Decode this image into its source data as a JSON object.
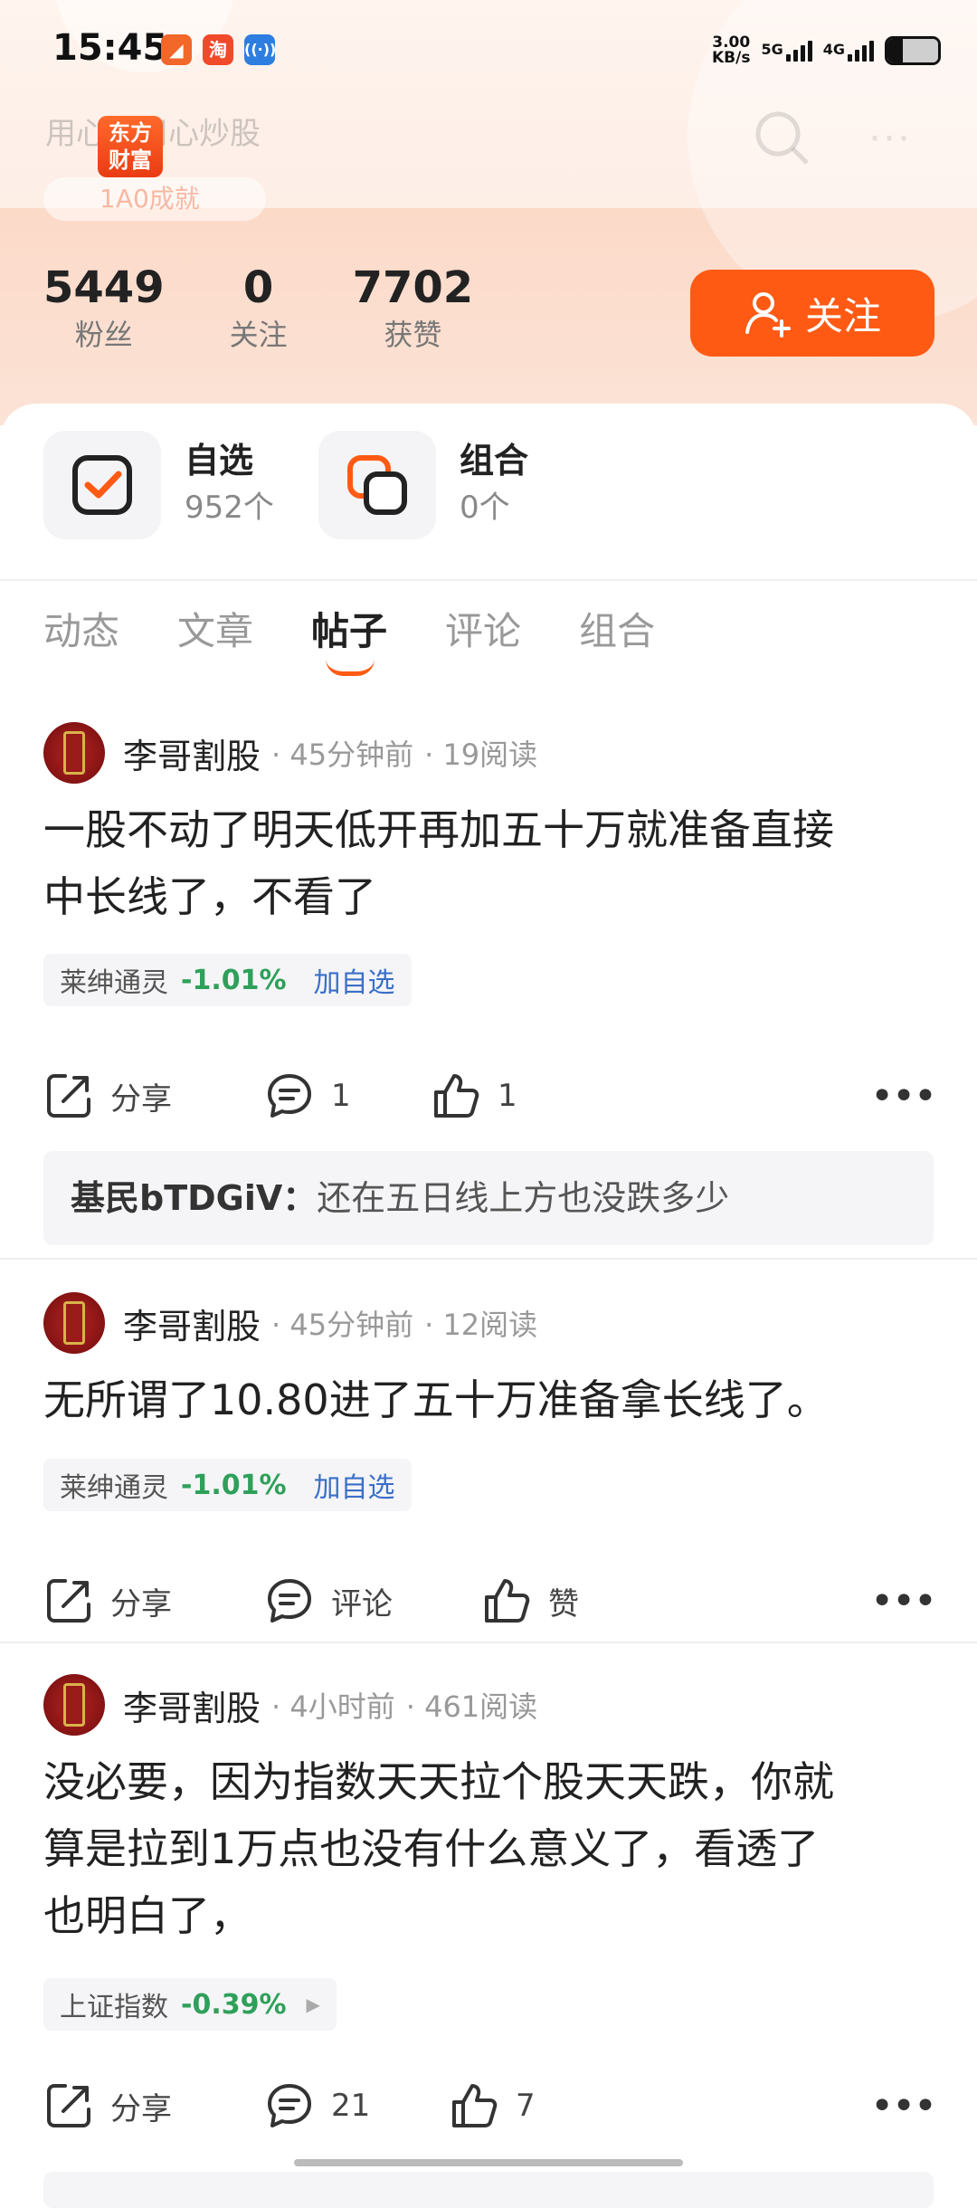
{
  "status": {
    "time": "15:45",
    "speed_value": "3.00",
    "speed_unit": "KB/s",
    "net1": "5G",
    "net2": "4G",
    "battery_level": 0.3
  },
  "header": {
    "logo_line1": "东方",
    "logo_line2": "财富",
    "slogan": "用心，用心炒股",
    "honor": "1A0成就"
  },
  "profile": {
    "stats": [
      {
        "value": "5449",
        "label": "粉丝"
      },
      {
        "value": "0",
        "label": "关注"
      },
      {
        "value": "7702",
        "label": "获赞"
      }
    ],
    "follow_label": "关注"
  },
  "quick": [
    {
      "title": "自选",
      "sub": "952个"
    },
    {
      "title": "组合",
      "sub": "0个"
    }
  ],
  "tabs": [
    {
      "label": "动态"
    },
    {
      "label": "文章"
    },
    {
      "label": "帖子"
    },
    {
      "label": "评论"
    },
    {
      "label": "组合"
    }
  ],
  "posts": [
    {
      "author": "李哥割股",
      "time": "· 45分钟前",
      "reads": "· 19阅读",
      "line1": "一股不动了明天低开再加五十万就准备直接",
      "line2": "中长线了，不看了",
      "stock_name": "莱绅通灵",
      "stock_pct": "-1.01%",
      "stock_add": "加自选",
      "share": "分享",
      "comments": "1",
      "likes": "1",
      "comment_user": "基民bTDGiV：",
      "comment_text": "还在五日线上方也没跌多少"
    },
    {
      "author": "李哥割股",
      "time": "· 45分钟前",
      "reads": "· 12阅读",
      "line1": "无所谓了10.80进了五十万准备拿长线了。",
      "stock_name": "莱绅通灵",
      "stock_pct": "-1.01%",
      "stock_add": "加自选",
      "share": "分享",
      "comments": "评论",
      "likes": "赞"
    },
    {
      "author": "李哥割股",
      "time": "· 4小时前",
      "reads": "· 461阅读",
      "line1": "没必要，因为指数天天拉个股天天跌，你就",
      "line2": "算是拉到1万点也没有什么意义了，看透了",
      "line3": "也明白了，",
      "stock_name": "上证指数",
      "stock_pct": "-0.39%",
      "share": "分享",
      "comments": "21",
      "likes": "7"
    }
  ],
  "colors": {
    "accent": "#ff5a14",
    "down_green": "#2fa05a",
    "link_blue": "#3a6fc8"
  }
}
